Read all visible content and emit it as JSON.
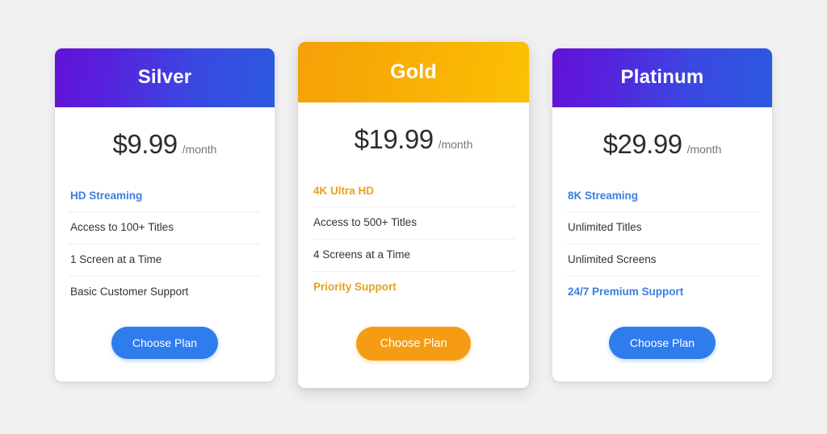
{
  "background_color": "#f1f1f2",
  "plans": [
    {
      "id": "silver",
      "name": "Silver",
      "featured": false,
      "header_gradient_from": "#6411d8",
      "header_gradient_to": "#2a5ae0",
      "accent_color": "#3b7fe0",
      "price": "$9.99",
      "period": "/month",
      "features": [
        {
          "label": "HD Streaming",
          "highlight": true
        },
        {
          "label": "Access to 100+ Titles",
          "highlight": false
        },
        {
          "label": "1 Screen at a Time",
          "highlight": false
        },
        {
          "label": "Basic Customer Support",
          "highlight": false
        }
      ],
      "cta_label": "Choose Plan",
      "cta_color": "#2f7ced"
    },
    {
      "id": "gold",
      "name": "Gold",
      "featured": true,
      "header_gradient_from": "#f5a009",
      "header_gradient_to": "#fcc003",
      "accent_color": "#e8a020",
      "price": "$19.99",
      "period": "/month",
      "features": [
        {
          "label": "4K Ultra HD",
          "highlight": true
        },
        {
          "label": "Access to 500+ Titles",
          "highlight": false
        },
        {
          "label": "4 Screens at a Time",
          "highlight": false
        },
        {
          "label": "Priority Support",
          "highlight": true
        }
      ],
      "cta_label": "Choose Plan",
      "cta_color": "#f59c14"
    },
    {
      "id": "platinum",
      "name": "Platinum",
      "featured": false,
      "header_gradient_from": "#6411d8",
      "header_gradient_to": "#2a5ae0",
      "accent_color": "#3b7fe0",
      "price": "$29.99",
      "period": "/month",
      "features": [
        {
          "label": "8K Streaming",
          "highlight": true
        },
        {
          "label": "Unlimited Titles",
          "highlight": false
        },
        {
          "label": "Unlimited Screens",
          "highlight": false
        },
        {
          "label": "24/7 Premium Support",
          "highlight": true
        }
      ],
      "cta_label": "Choose Plan",
      "cta_color": "#2f7ced"
    }
  ]
}
